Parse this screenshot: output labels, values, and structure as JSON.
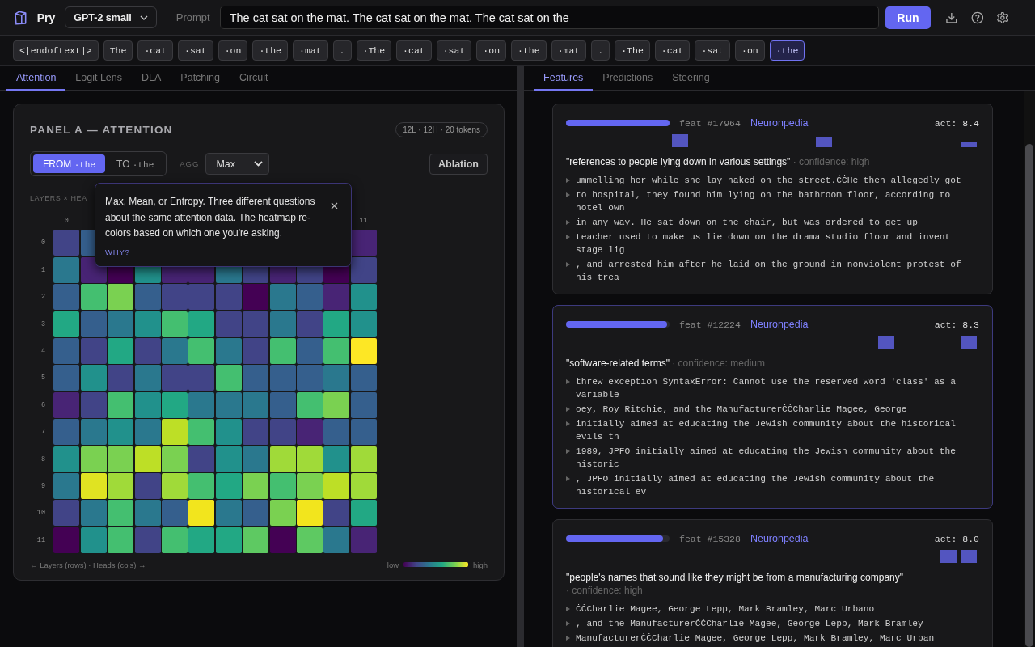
{
  "header": {
    "app_name": "Pry",
    "model": "GPT-2 small",
    "prompt_label": "Prompt",
    "prompt": "The cat sat on the mat. The cat sat on the mat. The cat sat on the",
    "run_label": "Run"
  },
  "tokens": [
    {
      "text": "<|endoftext|>",
      "selected": false
    },
    {
      "text": "The",
      "selected": false
    },
    {
      "text": "·cat",
      "selected": false
    },
    {
      "text": "·sat",
      "selected": false
    },
    {
      "text": "·on",
      "selected": false
    },
    {
      "text": "·the",
      "selected": false
    },
    {
      "text": "·mat",
      "selected": false
    },
    {
      "text": ".",
      "selected": false
    },
    {
      "text": "·The",
      "selected": false
    },
    {
      "text": "·cat",
      "selected": false
    },
    {
      "text": "·sat",
      "selected": false
    },
    {
      "text": "·on",
      "selected": false
    },
    {
      "text": "·the",
      "selected": false
    },
    {
      "text": "·mat",
      "selected": false
    },
    {
      "text": ".",
      "selected": false
    },
    {
      "text": "·The",
      "selected": false
    },
    {
      "text": "·cat",
      "selected": false
    },
    {
      "text": "·sat",
      "selected": false
    },
    {
      "text": "·on",
      "selected": false
    },
    {
      "text": "·the",
      "selected": true
    }
  ],
  "left_tabs": [
    {
      "label": "Attention",
      "selected": true
    },
    {
      "label": "Logit Lens",
      "selected": false
    },
    {
      "label": "DLA",
      "selected": false
    },
    {
      "label": "Patching",
      "selected": false
    },
    {
      "label": "Circuit",
      "selected": false
    }
  ],
  "panel": {
    "title": "PANEL A — ATTENTION",
    "badge": "12L · 12H · 20 tokens",
    "direction": [
      {
        "label": "FROM",
        "token": "·the",
        "selected": true
      },
      {
        "label": "TO",
        "token": "·the",
        "selected": false
      }
    ],
    "agg_label": "AGG",
    "agg_value": "Max",
    "ablation_label": "Ablation",
    "grid_label": "LAYERS × HEA",
    "column_labels": [
      {
        "label": "0",
        "kind": "first"
      },
      {
        "label": "11",
        "kind": "last"
      }
    ],
    "rows": [
      {
        "label": "0",
        "cells": [
          {
            "color": "#414487",
            "kind": "flow"
          },
          {
            "color": "#355f8d",
            "kind": "flow"
          },
          {
            "color": "#482475",
            "kind": "last"
          }
        ]
      },
      {
        "label": "1",
        "cells": [
          {
            "color": "#2a788e"
          },
          {
            "color": "#482475"
          },
          {
            "color": "#440154"
          },
          {
            "color": "#21918c"
          },
          {
            "color": "#482475"
          },
          {
            "color": "#482475"
          },
          {
            "color": "#2a788e"
          },
          {
            "color": "#414487"
          },
          {
            "color": "#482475"
          },
          {
            "color": "#414487"
          },
          {
            "color": "#440154"
          },
          {
            "color": "#414487"
          }
        ]
      },
      {
        "label": "2",
        "cells": [
          {
            "color": "#355f8d"
          },
          {
            "color": "#44bf70"
          },
          {
            "color": "#7ad151"
          },
          {
            "color": "#355f8d"
          },
          {
            "color": "#414487"
          },
          {
            "color": "#414487"
          },
          {
            "color": "#414487"
          },
          {
            "color": "#440154"
          },
          {
            "color": "#2a788e"
          },
          {
            "color": "#355f8d"
          },
          {
            "color": "#482475"
          },
          {
            "color": "#21918c"
          }
        ]
      },
      {
        "label": "3",
        "cells": [
          {
            "color": "#22a884"
          },
          {
            "color": "#355f8d"
          },
          {
            "color": "#2a788e"
          },
          {
            "color": "#21918c"
          },
          {
            "color": "#44bf70"
          },
          {
            "color": "#22a884"
          },
          {
            "color": "#414487"
          },
          {
            "color": "#414487"
          },
          {
            "color": "#2a788e"
          },
          {
            "color": "#414487"
          },
          {
            "color": "#22a884"
          },
          {
            "color": "#21918c"
          }
        ]
      },
      {
        "label": "4",
        "cells": [
          {
            "color": "#355f8d"
          },
          {
            "color": "#414487"
          },
          {
            "color": "#22a884"
          },
          {
            "color": "#414487"
          },
          {
            "color": "#2a788e"
          },
          {
            "color": "#44bf70"
          },
          {
            "color": "#2a788e"
          },
          {
            "color": "#414487"
          },
          {
            "color": "#44bf70"
          },
          {
            "color": "#355f8d"
          },
          {
            "color": "#44bf70"
          },
          {
            "color": "#fde725"
          }
        ]
      },
      {
        "label": "5",
        "cells": [
          {
            "color": "#355f8d"
          },
          {
            "color": "#21918c"
          },
          {
            "color": "#414487"
          },
          {
            "color": "#2a788e"
          },
          {
            "color": "#414487"
          },
          {
            "color": "#414487"
          },
          {
            "color": "#44bf70"
          },
          {
            "color": "#355f8d"
          },
          {
            "color": "#355f8d"
          },
          {
            "color": "#355f8d"
          },
          {
            "color": "#2a788e"
          },
          {
            "color": "#355f8d"
          }
        ]
      },
      {
        "label": "6",
        "cells": [
          {
            "color": "#482475"
          },
          {
            "color": "#414487"
          },
          {
            "color": "#44bf70"
          },
          {
            "color": "#21918c"
          },
          {
            "color": "#22a884"
          },
          {
            "color": "#2a788e"
          },
          {
            "color": "#2a788e"
          },
          {
            "color": "#2a788e"
          },
          {
            "color": "#355f8d"
          },
          {
            "color": "#44bf70"
          },
          {
            "color": "#7ad151"
          },
          {
            "color": "#355f8d"
          }
        ]
      },
      {
        "label": "7",
        "cells": [
          {
            "color": "#355f8d"
          },
          {
            "color": "#2a788e"
          },
          {
            "color": "#21918c"
          },
          {
            "color": "#2a788e"
          },
          {
            "color": "#bddf26"
          },
          {
            "color": "#44bf70"
          },
          {
            "color": "#21918c"
          },
          {
            "color": "#414487"
          },
          {
            "color": "#414487"
          },
          {
            "color": "#482475"
          },
          {
            "color": "#355f8d"
          },
          {
            "color": "#355f8d"
          }
        ]
      },
      {
        "label": "8",
        "cells": [
          {
            "color": "#21918c"
          },
          {
            "color": "#7ad151"
          },
          {
            "color": "#7ad151"
          },
          {
            "color": "#bddf26"
          },
          {
            "color": "#7ad151"
          },
          {
            "color": "#414487"
          },
          {
            "color": "#21918c"
          },
          {
            "color": "#2a788e"
          },
          {
            "color": "#a0da39"
          },
          {
            "color": "#a0da39"
          },
          {
            "color": "#21918c"
          },
          {
            "color": "#a0da39"
          }
        ]
      },
      {
        "label": "9",
        "cells": [
          {
            "color": "#2a788e"
          },
          {
            "color": "#e0e322"
          },
          {
            "color": "#a0da39"
          },
          {
            "color": "#414487"
          },
          {
            "color": "#a0da39"
          },
          {
            "color": "#44bf70"
          },
          {
            "color": "#22a884"
          },
          {
            "color": "#7ad151"
          },
          {
            "color": "#44bf70"
          },
          {
            "color": "#7ad151"
          },
          {
            "color": "#bddf26"
          },
          {
            "color": "#a0da39"
          }
        ]
      },
      {
        "label": "10",
        "cells": [
          {
            "color": "#414487"
          },
          {
            "color": "#2a788e"
          },
          {
            "color": "#44bf70"
          },
          {
            "color": "#2a788e"
          },
          {
            "color": "#355f8d"
          },
          {
            "color": "#f2e51d"
          },
          {
            "color": "#2a788e"
          },
          {
            "color": "#355f8d"
          },
          {
            "color": "#7ad151"
          },
          {
            "color": "#f2e51d"
          },
          {
            "color": "#414487"
          },
          {
            "color": "#22a884"
          }
        ]
      },
      {
        "label": "11",
        "cells": [
          {
            "color": "#440154"
          },
          {
            "color": "#21918c"
          },
          {
            "color": "#44bf70"
          },
          {
            "color": "#414487"
          },
          {
            "color": "#44bf70"
          },
          {
            "color": "#22a884"
          },
          {
            "color": "#22a884"
          },
          {
            "color": "#5ec962"
          },
          {
            "color": "#440154"
          },
          {
            "color": "#5ec962"
          },
          {
            "color": "#2a788e"
          },
          {
            "color": "#482475"
          }
        ]
      }
    ],
    "axis_caption": "← Layers (rows) · Heads (cols) →",
    "legend_low": "low",
    "legend_high": "high",
    "tooltip": {
      "text": "Max, Mean, or Entropy. Three different questions about the same attention data. The heatmap re-colors based on which one you're asking.",
      "link": "WHY?"
    }
  },
  "right_tabs": [
    {
      "label": "Features",
      "selected": true
    },
    {
      "label": "Predictions",
      "selected": false
    },
    {
      "label": "Steering",
      "selected": false
    }
  ],
  "features": [
    {
      "level": 1.0,
      "feat": "feat #17964",
      "link": "Neuronpedia",
      "act": "act: 8.4",
      "selected": false,
      "activations": [
        {
          "kind": "none"
        },
        {
          "kind": "none"
        },
        {
          "kind": "none"
        },
        {
          "kind": "none"
        },
        {
          "kind": "none"
        },
        {
          "kind": "full"
        },
        {
          "kind": "none"
        },
        {
          "kind": "none"
        },
        {
          "kind": "none"
        },
        {
          "kind": "none"
        },
        {
          "kind": "none"
        },
        {
          "kind": "none"
        },
        {
          "kind": "mid"
        },
        {
          "kind": "none"
        },
        {
          "kind": "none"
        },
        {
          "kind": "none"
        },
        {
          "kind": "none"
        },
        {
          "kind": "none"
        },
        {
          "kind": "none"
        },
        {
          "kind": "low"
        }
      ],
      "description": "\"references to people lying down in various settings\"",
      "confidence": "· confidence: high",
      "examples": [
        "ummelling her while she lay naked on the street.ĊĊHe then allegedly got",
        "to hospital, they found him lying on the bathroom floor, according to hotel own",
        "in any way. He sat down on the chair, but was ordered to get up",
        "teacher used to make us lie down on the drama studio floor and invent stage lig",
        ", and arrested him after he laid on the ground in nonviolent protest of his trea"
      ]
    },
    {
      "level": 0.98,
      "feat": "feat #12224",
      "link": "Neuronpedia",
      "act": "act: 8.3",
      "selected": true,
      "activations": [
        {
          "kind": "none"
        },
        {
          "kind": "none"
        },
        {
          "kind": "none"
        },
        {
          "kind": "none"
        },
        {
          "kind": "none"
        },
        {
          "kind": "none"
        },
        {
          "kind": "none"
        },
        {
          "kind": "none"
        },
        {
          "kind": "none"
        },
        {
          "kind": "none"
        },
        {
          "kind": "none"
        },
        {
          "kind": "none"
        },
        {
          "kind": "none"
        },
        {
          "kind": "none"
        },
        {
          "kind": "none"
        },
        {
          "kind": "high"
        },
        {
          "kind": "none"
        },
        {
          "kind": "none"
        },
        {
          "kind": "none"
        },
        {
          "kind": "full"
        }
      ],
      "description": "\"software-related terms\"",
      "confidence": "· confidence: medium",
      "examples": [
        "threw exception SyntaxError: Cannot use the reserved word 'class' as a variable",
        "oey, Roy Ritchie, and the ManufacturerĊĊCharlie Magee, George",
        "initially aimed at educating the Jewish community about the historical evils th",
        "1989, JPFO initially aimed at educating the Jewish community about the historic",
        ", JPFO initially aimed at educating the Jewish community about the historical ev"
      ]
    },
    {
      "level": 0.94,
      "feat": "feat #15328",
      "link": "Neuronpedia",
      "act": "act: 8.0",
      "selected": false,
      "activations": [
        {
          "kind": "none"
        },
        {
          "kind": "none"
        },
        {
          "kind": "none"
        },
        {
          "kind": "none"
        },
        {
          "kind": "none"
        },
        {
          "kind": "none"
        },
        {
          "kind": "none"
        },
        {
          "kind": "none"
        },
        {
          "kind": "none"
        },
        {
          "kind": "none"
        },
        {
          "kind": "none"
        },
        {
          "kind": "none"
        },
        {
          "kind": "none"
        },
        {
          "kind": "none"
        },
        {
          "kind": "none"
        },
        {
          "kind": "none"
        },
        {
          "kind": "none"
        },
        {
          "kind": "none"
        },
        {
          "kind": "full"
        },
        {
          "kind": "full"
        }
      ],
      "description": "\"people's names that sound like they might be from a manufacturing company\"",
      "confidence": "· confidence: high",
      "examples": [
        "ĊĊCharlie Magee, George Lepp, Mark Bramley, Marc Urbano",
        ", and the ManufacturerĊĊCharlie Magee, George Lepp, Mark Bramley",
        "ManufacturerĊĊCharlie Magee, George Lepp, Mark Bramley, Marc Urban"
      ]
    }
  ]
}
